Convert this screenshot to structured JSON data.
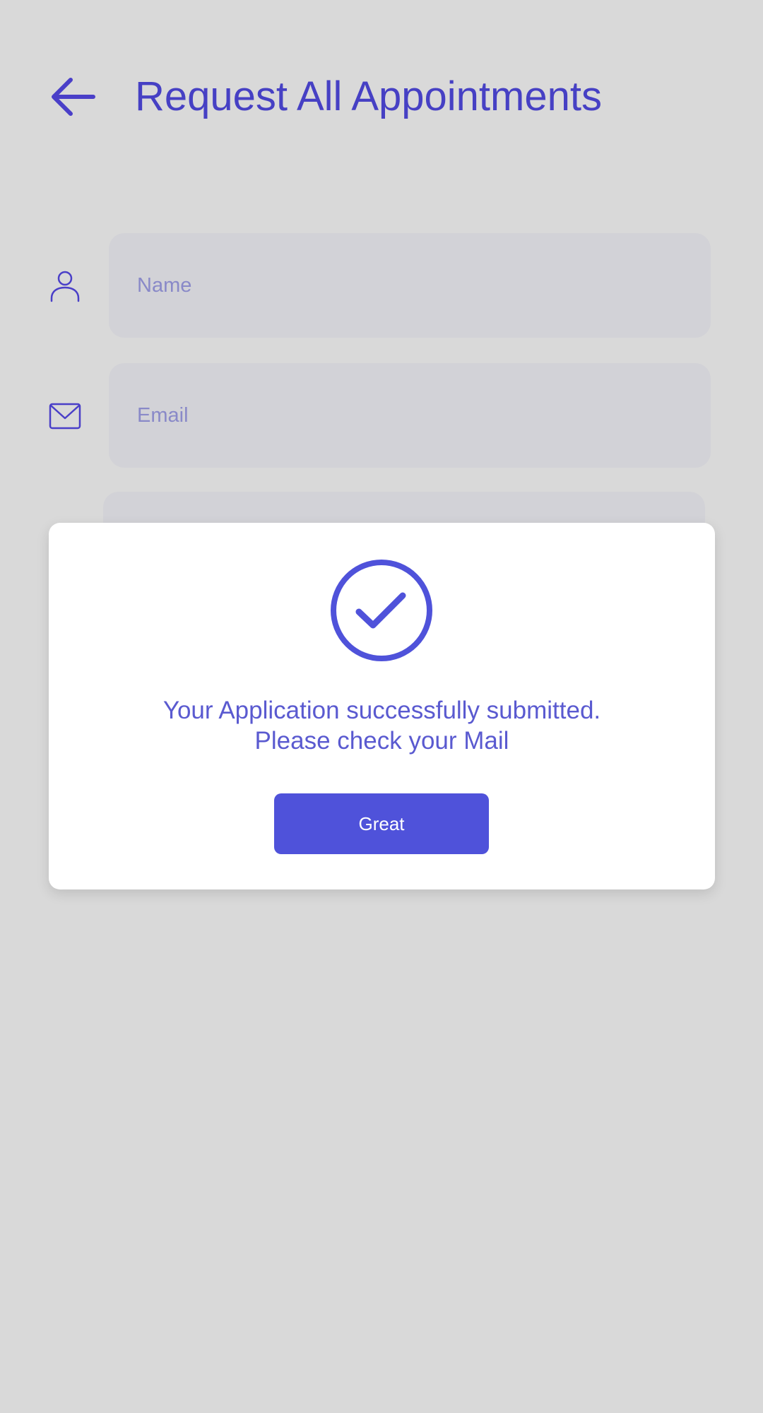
{
  "header": {
    "back_icon": "arrow-left-icon",
    "title": "Request All Appointments"
  },
  "form": {
    "name_field": {
      "icon": "user-icon",
      "placeholder": "Name",
      "value": ""
    },
    "email_field": {
      "icon": "mail-icon",
      "placeholder": "Email",
      "value": ""
    }
  },
  "dialog": {
    "icon": "check-circle-icon",
    "message_line1": "Your Application successfully submitted.",
    "message_line2": "Please check your Mail",
    "button_label": "Great"
  },
  "colors": {
    "accent": "#4f52da",
    "title": "#4640c4",
    "overlay_background": "#d9d9d9",
    "input_background": "#d2d2d7",
    "placeholder": "#8989c8",
    "message": "#5a5ad0"
  }
}
